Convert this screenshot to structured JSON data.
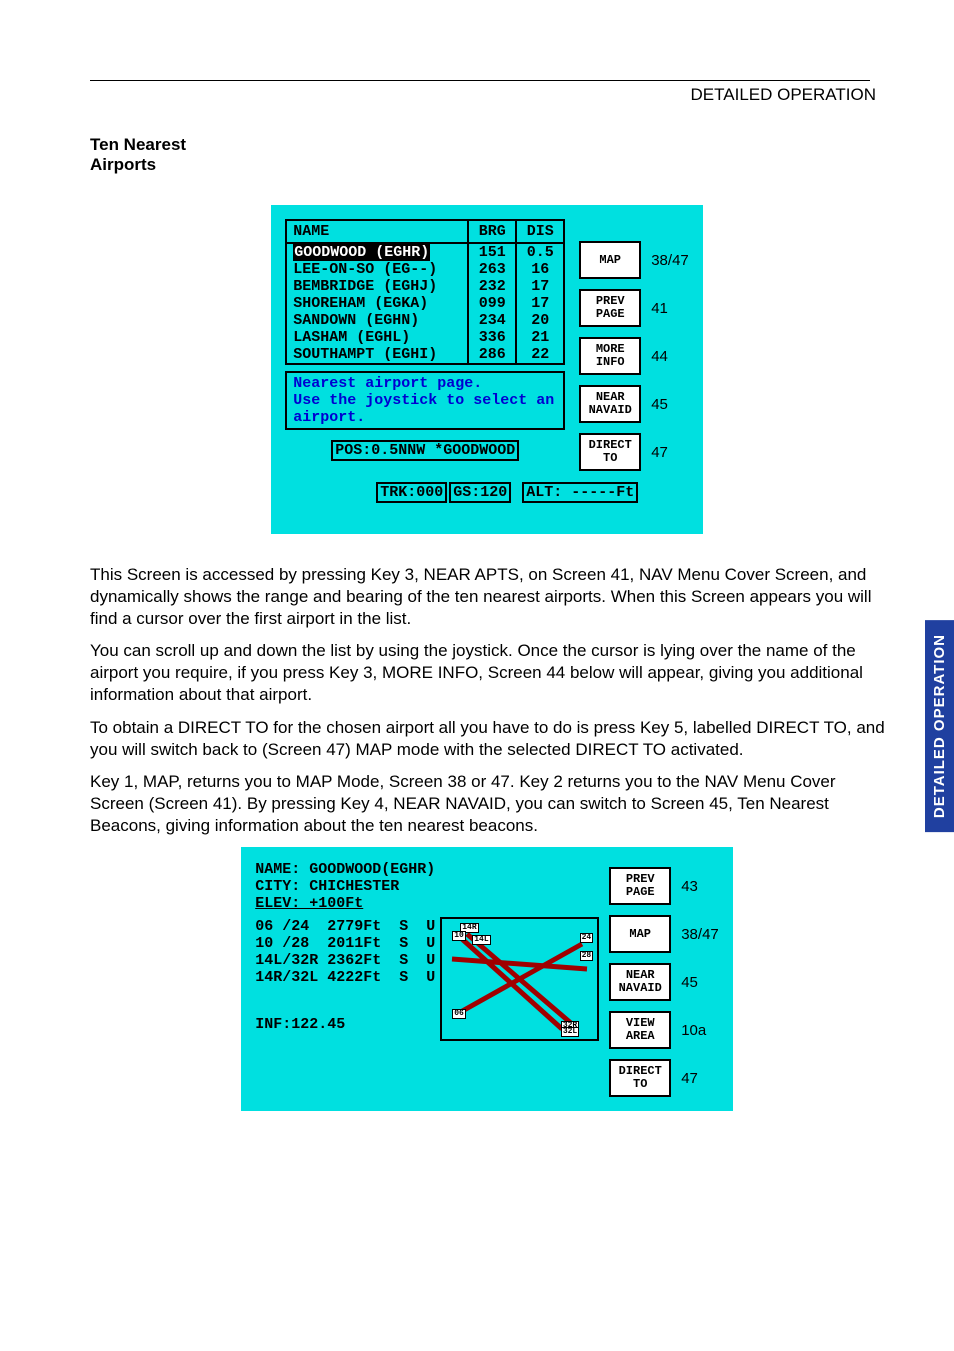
{
  "header": {
    "section": "DETAILED OPERATION"
  },
  "title": "Ten Nearest Airports",
  "side_tab": "DETAILED OPERATION",
  "screen1": {
    "headers": {
      "name": "NAME",
      "brg": "BRG",
      "dis": "DIS"
    },
    "rows": [
      {
        "name": "GOODWOOD (EGHR)",
        "brg": "151",
        "dis": "0.5",
        "selected": true
      },
      {
        "name": "LEE-ON-SO (EG--)",
        "brg": "263",
        "dis": "16"
      },
      {
        "name": "BEMBRIDGE (EGHJ)",
        "brg": "232",
        "dis": "17"
      },
      {
        "name": "SHOREHAM (EGKA)",
        "brg": "099",
        "dis": "17"
      },
      {
        "name": "SANDOWN (EGHN)",
        "brg": "234",
        "dis": "20"
      },
      {
        "name": "LASHAM (EGHL)",
        "brg": "336",
        "dis": "21"
      },
      {
        "name": "SOUTHAMPT (EGHI)",
        "brg": "286",
        "dis": "22"
      }
    ],
    "hint1": "Nearest airport page.",
    "hint2": "Use the joystick to select an airport.",
    "pos": "POS:0.5NNW *GOODWOOD",
    "trk": "TRK:000",
    "gs": "GS:120",
    "alt": "ALT: -----Ft",
    "buttons": [
      {
        "label": "MAP",
        "ref": "38/47"
      },
      {
        "label": "PREV\nPAGE",
        "ref": "41"
      },
      {
        "label": "MORE\nINFO",
        "ref": "44"
      },
      {
        "label": "NEAR\nNAVAID",
        "ref": "45"
      },
      {
        "label": "DIRECT\nTO",
        "ref": "47"
      }
    ]
  },
  "paragraphs": [
    "This Screen is accessed by pressing Key 3, NEAR APTS, on Screen 41, NAV Menu Cover Screen, and dynamically shows the range and bearing of the ten nearest airports.  When this Screen appears you will find a cursor over the first airport in the list.",
    "You can scroll up and down the list by using the joystick.  Once the cursor is lying over the name of the airport you require, if you press Key 3, MORE INFO, Screen 44 below will appear, giving you additional information about that airport.",
    "To obtain a DIRECT TO for the chosen airport all you have to do is press Key 5, labelled DIRECT TO, and you will switch back to (Screen 47) MAP mode with the selected DIRECT TO activated.",
    "Key 1, MAP, returns you to MAP Mode, Screen 38 or 47.  Key 2 returns you to the NAV Menu Cover Screen (Screen 41). By pressing Key 4, NEAR NAVAID, you can switch to Screen 45, Ten Nearest Beacons, giving information about the ten nearest beacons."
  ],
  "screen2": {
    "name": "NAME: GOODWOOD(EGHR)",
    "city": "CITY: CHICHESTER",
    "elev": "ELEV: +100Ft",
    "runways": [
      "06 /24  2779Ft  S  U",
      "10 /28  2011Ft  S  U",
      "14L/32R 2362Ft  S  U",
      "14R/32L 4222Ft  S  U"
    ],
    "diagram_tags": [
      "14R",
      "10",
      "14L",
      "24",
      "28",
      "06",
      "32R",
      "32L"
    ],
    "inf": "INF:122.45",
    "buttons": [
      {
        "label": "PREV\nPAGE",
        "ref": "43"
      },
      {
        "label": "MAP",
        "ref": "38/47"
      },
      {
        "label": "NEAR\nNAVAID",
        "ref": "45"
      },
      {
        "label": "VIEW\nAREA",
        "ref": "10a"
      },
      {
        "label": "DIRECT\nTO",
        "ref": "47"
      }
    ]
  }
}
